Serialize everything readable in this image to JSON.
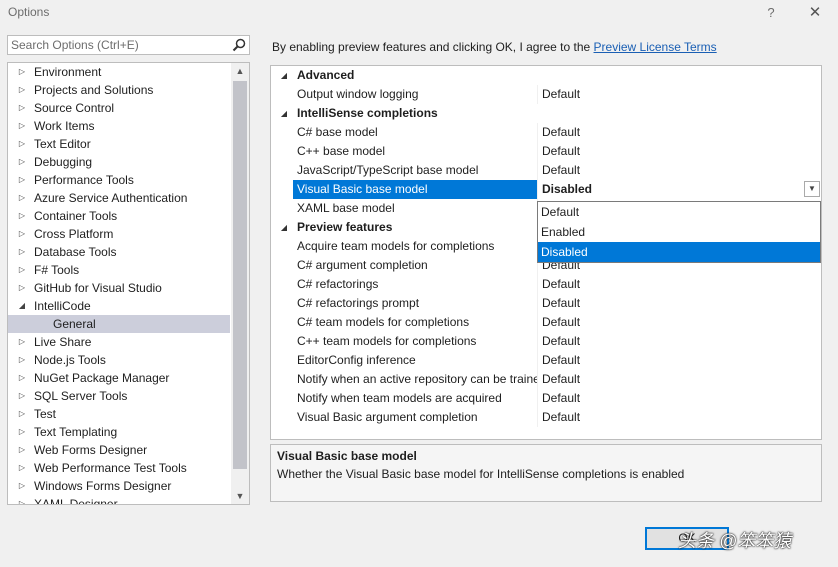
{
  "window": {
    "title": "Options",
    "help_label": "?",
    "close_label": "✕"
  },
  "search": {
    "placeholder": "Search Options (Ctrl+E)",
    "value": ""
  },
  "tree": {
    "items": [
      {
        "label": "Environment",
        "expanded": false
      },
      {
        "label": "Projects and Solutions",
        "expanded": false
      },
      {
        "label": "Source Control",
        "expanded": false
      },
      {
        "label": "Work Items",
        "expanded": false
      },
      {
        "label": "Text Editor",
        "expanded": false
      },
      {
        "label": "Debugging",
        "expanded": false
      },
      {
        "label": "Performance Tools",
        "expanded": false
      },
      {
        "label": "Azure Service Authentication",
        "expanded": false
      },
      {
        "label": "Container Tools",
        "expanded": false
      },
      {
        "label": "Cross Platform",
        "expanded": false
      },
      {
        "label": "Database Tools",
        "expanded": false
      },
      {
        "label": "F# Tools",
        "expanded": false
      },
      {
        "label": "GitHub for Visual Studio",
        "expanded": false
      },
      {
        "label": "IntelliCode",
        "expanded": true
      },
      {
        "label": "General",
        "child": true,
        "selected": true
      },
      {
        "label": "Live Share",
        "expanded": false
      },
      {
        "label": "Node.js Tools",
        "expanded": false
      },
      {
        "label": "NuGet Package Manager",
        "expanded": false
      },
      {
        "label": "SQL Server Tools",
        "expanded": false
      },
      {
        "label": "Test",
        "expanded": false
      },
      {
        "label": "Text Templating",
        "expanded": false
      },
      {
        "label": "Web Forms Designer",
        "expanded": false
      },
      {
        "label": "Web Performance Test Tools",
        "expanded": false
      },
      {
        "label": "Windows Forms Designer",
        "expanded": false
      },
      {
        "label": "XAML Designer",
        "expanded": false
      }
    ]
  },
  "agreement": {
    "text": "By enabling preview features and clicking OK, I agree to the ",
    "link_label": "Preview License Terms"
  },
  "properties": {
    "rows": [
      {
        "type": "category",
        "label": "Advanced"
      },
      {
        "type": "property",
        "name": "Output window logging",
        "value": "Default"
      },
      {
        "type": "category",
        "label": "IntelliSense completions"
      },
      {
        "type": "property",
        "name": "C# base model",
        "value": "Default"
      },
      {
        "type": "property",
        "name": "C++ base model",
        "value": "Default"
      },
      {
        "type": "property",
        "name": "JavaScript/TypeScript base model",
        "value": "Default"
      },
      {
        "type": "property",
        "name": "Visual Basic base model",
        "value": "Disabled",
        "selected": true
      },
      {
        "type": "property",
        "name": "XAML base model",
        "value": "Default"
      },
      {
        "type": "category",
        "label": "Preview features"
      },
      {
        "type": "property",
        "name": "Acquire team models for completions",
        "value": "Default"
      },
      {
        "type": "property",
        "name": "C# argument completion",
        "value": "Default"
      },
      {
        "type": "property",
        "name": "C# refactorings",
        "value": "Default"
      },
      {
        "type": "property",
        "name": "C# refactorings prompt",
        "value": "Default"
      },
      {
        "type": "property",
        "name": "C# team models for completions",
        "value": "Default"
      },
      {
        "type": "property",
        "name": "C++ team models for completions",
        "value": "Default"
      },
      {
        "type": "property",
        "name": "EditorConfig inference",
        "value": "Default"
      },
      {
        "type": "property",
        "name": "Notify when an active repository can be trained",
        "value": "Default"
      },
      {
        "type": "property",
        "name": "Notify when team models are acquired",
        "value": "Default"
      },
      {
        "type": "property",
        "name": "Visual Basic argument completion",
        "value": "Default"
      }
    ]
  },
  "dropdown": {
    "options": [
      {
        "label": "Default",
        "selected": false
      },
      {
        "label": "Enabled",
        "selected": false
      },
      {
        "label": "Disabled",
        "selected": true
      }
    ]
  },
  "description": {
    "title": "Visual Basic base model",
    "text": "Whether the Visual Basic base model for IntelliSense completions is enabled"
  },
  "buttons": {
    "ok_label": "OK"
  },
  "watermark": {
    "text": "头条 @笨笨猿"
  }
}
